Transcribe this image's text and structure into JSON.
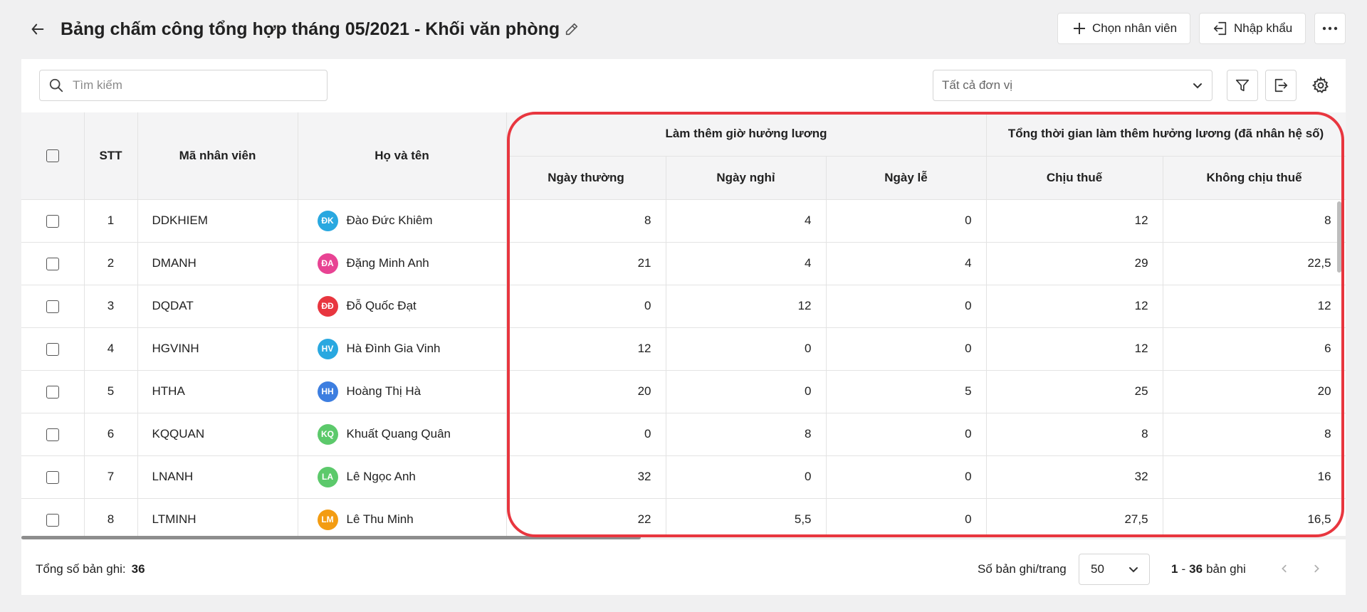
{
  "header": {
    "title": "Bảng chấm công tổng hợp tháng 05/2021 - Khối văn phòng",
    "choose_employee": "Chọn nhân viên",
    "import": "Nhập khẩu"
  },
  "toolbar": {
    "search_placeholder": "Tìm kiếm",
    "unit_filter": "Tất cả đơn vị"
  },
  "table": {
    "headers": {
      "stt": "STT",
      "code": "Mã nhân viên",
      "name": "Họ và tên",
      "group_overtime": "Làm thêm giờ hưởng lương",
      "group_total": "Tổng thời gian làm thêm hưởng lương (đã nhân hệ số)",
      "weekday": "Ngày thường",
      "dayoff": "Ngày nghỉ",
      "holiday": "Ngày lễ",
      "taxable": "Chịu thuế",
      "nontaxable": "Không chịu thuế"
    },
    "rows": [
      {
        "stt": "1",
        "code": "DDKHIEM",
        "initials": "ĐK",
        "avatar_color": "#29a8e0",
        "name": "Đào Đức Khiêm",
        "weekday": "8",
        "dayoff": "4",
        "holiday": "0",
        "taxable": "12",
        "nontaxable": "8"
      },
      {
        "stt": "2",
        "code": "DMANH",
        "initials": "ĐA",
        "avatar_color": "#e84393",
        "name": "Đặng Minh Anh",
        "weekday": "21",
        "dayoff": "4",
        "holiday": "4",
        "taxable": "29",
        "nontaxable": "22,5"
      },
      {
        "stt": "3",
        "code": "DQDAT",
        "initials": "ĐĐ",
        "avatar_color": "#e8363f",
        "name": "Đỗ Quốc Đạt",
        "weekday": "0",
        "dayoff": "12",
        "holiday": "0",
        "taxable": "12",
        "nontaxable": "12"
      },
      {
        "stt": "4",
        "code": "HGVINH",
        "initials": "HV",
        "avatar_color": "#29a8e0",
        "name": "Hà Đình Gia Vinh",
        "weekday": "12",
        "dayoff": "0",
        "holiday": "0",
        "taxable": "12",
        "nontaxable": "6"
      },
      {
        "stt": "5",
        "code": "HTHA",
        "initials": "HH",
        "avatar_color": "#3d7ee0",
        "name": "Hoàng Thị Hà",
        "weekday": "20",
        "dayoff": "0",
        "holiday": "5",
        "taxable": "25",
        "nontaxable": "20"
      },
      {
        "stt": "6",
        "code": "KQQUAN",
        "initials": "KQ",
        "avatar_color": "#5cc96b",
        "name": "Khuất Quang Quân",
        "weekday": "0",
        "dayoff": "8",
        "holiday": "0",
        "taxable": "8",
        "nontaxable": "8"
      },
      {
        "stt": "7",
        "code": "LNANH",
        "initials": "LA",
        "avatar_color": "#5cc96b",
        "name": "Lê Ngọc Anh",
        "weekday": "32",
        "dayoff": "0",
        "holiday": "0",
        "taxable": "32",
        "nontaxable": "16"
      },
      {
        "stt": "8",
        "code": "LTMINH",
        "initials": "LM",
        "avatar_color": "#f39c12",
        "name": "Lê Thu Minh",
        "weekday": "22",
        "dayoff": "5,5",
        "holiday": "0",
        "taxable": "27,5",
        "nontaxable": "16,5"
      }
    ]
  },
  "footer": {
    "total_label": "Tổng số bản ghi:",
    "total_value": "36",
    "per_page_label": "Số bản ghi/trang",
    "per_page_value": "50",
    "range_start": "1",
    "range_end": "36",
    "range_suffix": "bản ghi"
  }
}
